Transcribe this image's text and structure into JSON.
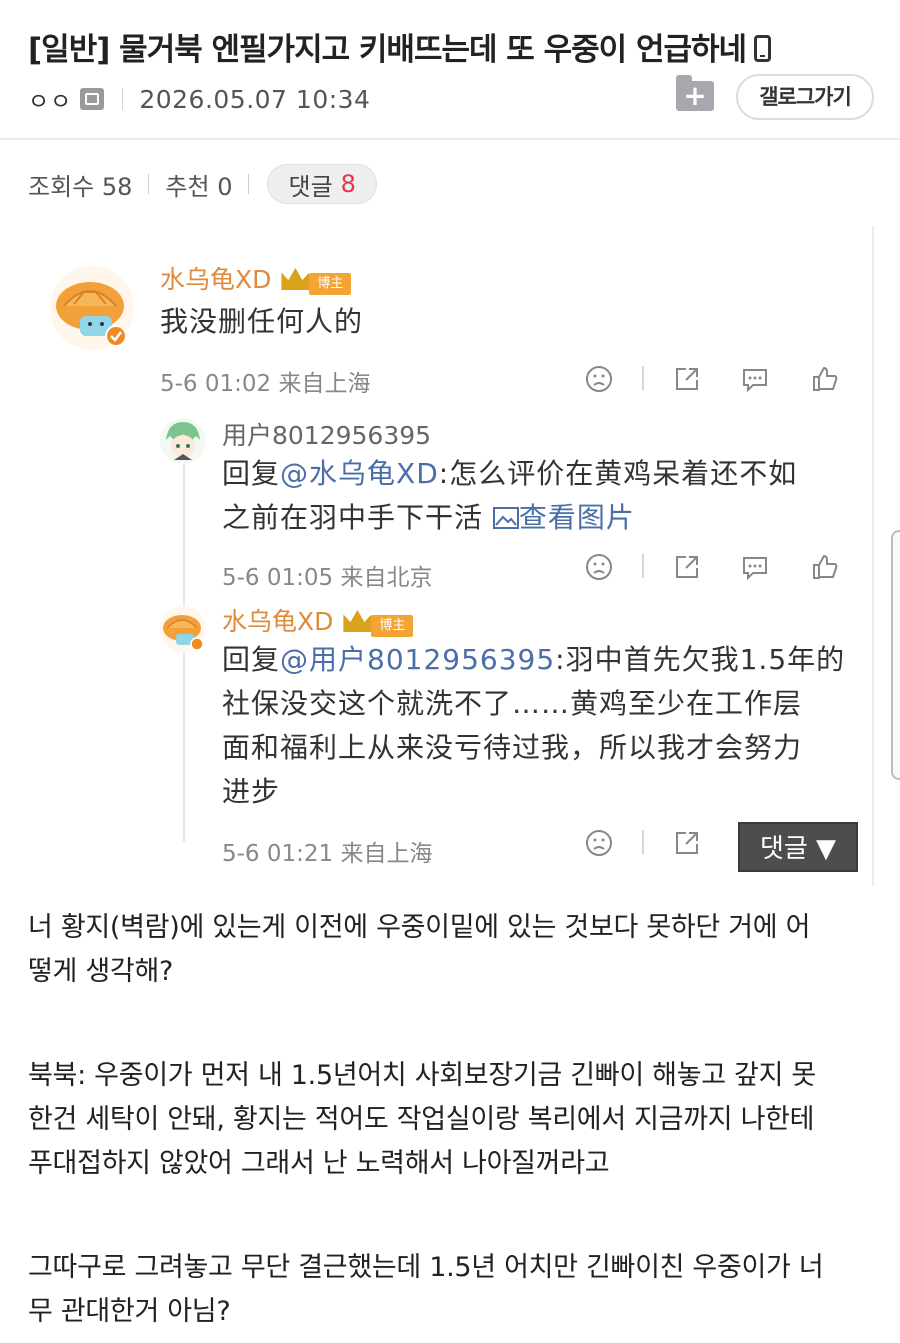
{
  "post": {
    "title": "[일반] 물거북 엔필가지고 키배뜨는데 또 우중이 언급하네",
    "writer": "ㅇㅇ",
    "date": "2026.05.07 10:34",
    "gallery_button": "갤로그가기",
    "views_label": "조회수 58",
    "recommend_label": "추천 0",
    "comment_label": "댓글",
    "comment_count": "8"
  },
  "screenshot": {
    "comment1": {
      "author": "水乌龟XD",
      "badge": "博主",
      "text": "我没删任何人的",
      "meta": "5-6 01:02 来自上海"
    },
    "reply1": {
      "author": "用户8012956395",
      "reply_prefix": "回复",
      "mention": "@水乌龟XD",
      "line1_rest": ":怎么评价在黄鸡呆着还不如",
      "line2": "之前在羽中手下干活",
      "view_image": "查看图片",
      "meta": "5-6 01:05 来自北京"
    },
    "reply2": {
      "author": "水乌龟XD",
      "badge": "博主",
      "reply_prefix": "回复",
      "mention": "@用户8012956395",
      "line1_rest": ":羽中首先欠我1.5年的",
      "line2": "社保没交这个就洗不了……黄鸡至少在工作层",
      "line3": "面和福利上从来没亏待过我，所以我才会努力",
      "line4": "进步",
      "meta": "5-6 01:21 来自上海"
    },
    "comment_button": "댓글 ▼"
  },
  "body": {
    "p1_l1": "너 황지(벽람)에 있는게 이전에 우중이밑에 있는 것보다 못하단 거에 어",
    "p1_l2": "떻게 생각해?",
    "p2_l1": "북북: 우중이가 먼저 내 1.5년어치 사회보장기금 긴빠이 해놓고 갚지 못",
    "p2_l2": "한건 세탁이 안돼, 황지는 적어도 작업실이랑 복리에서 지금까지 나한테",
    "p2_l3": "푸대접하지 않았어 그래서 난 노력해서 나아질꺼라고",
    "p3_l1": "그따구로 그려놓고 무단 결근했는데 1.5년 어치만 긴빠이친 우중이가 너",
    "p3_l2": "무 관대한거 아님?"
  },
  "colors": {
    "accent_red": "#e8334a",
    "weibo_name": "#e08b3c",
    "mention_blue": "#4a6fa8"
  }
}
